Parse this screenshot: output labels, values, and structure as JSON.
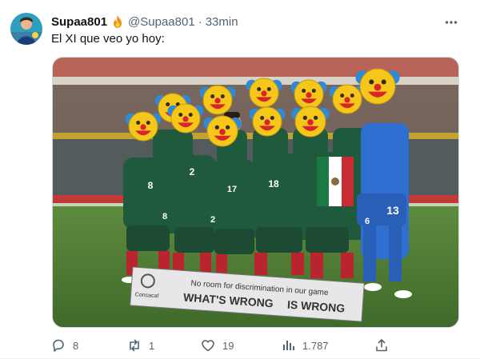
{
  "tweet": {
    "display_name": "Supaa801",
    "badge_icon": "fire-icon",
    "handle": "@Supaa801",
    "separator": "·",
    "time": "33min",
    "text": "El XI que veo yo hoy:",
    "more_icon": "more-icon"
  },
  "media": {
    "description_icon": "team-photo",
    "banner_line1": "No room for discrimination in our game",
    "banner_line2_a": "WHAT'S WRONG",
    "banner_line2_b": "IS WRONG",
    "banner_logo_text": "Concacaf",
    "jersey_numbers": [
      "8",
      "2",
      "17",
      "18",
      "13",
      "6",
      "8",
      "2"
    ]
  },
  "actions": {
    "replies": "8",
    "retweets": "1",
    "likes": "19",
    "views": "1.787"
  },
  "colors": {
    "text_primary": "#0f1419",
    "text_secondary": "#536471",
    "border": "#cfd9de",
    "pitch_green": "#4f7a35",
    "jersey_green": "#1f5a3c",
    "shorts_green": "#1c4a33",
    "socks_red": "#b8252f",
    "keeper_blue": "#2f6fd1",
    "clown_yellow": "#f6c71b",
    "clown_red": "#d8242a"
  }
}
